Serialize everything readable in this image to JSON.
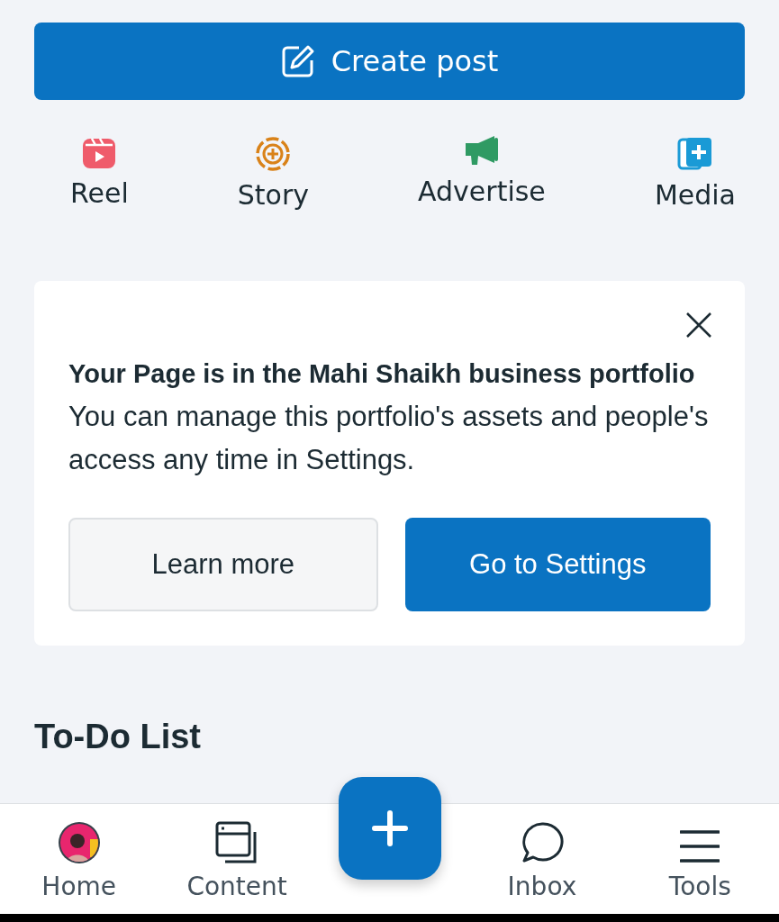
{
  "create_post": {
    "label": "Create post"
  },
  "quick_actions": [
    {
      "kind": "reel",
      "label": "Reel"
    },
    {
      "kind": "story",
      "label": "Story"
    },
    {
      "kind": "advertise",
      "label": "Advertise"
    },
    {
      "kind": "media",
      "label": "Media"
    }
  ],
  "notice": {
    "title": "Your Page is in the Mahi Shaikh business portfolio",
    "body": "You can manage this portfolio's assets and people's access any time in Settings.",
    "buttons": [
      {
        "kind": "secondary",
        "label": "Learn more"
      },
      {
        "kind": "primary",
        "label": "Go to Settings"
      }
    ]
  },
  "section_heading": "To-Do List",
  "bottom_nav": [
    {
      "kind": "avatar",
      "label": "Home"
    },
    {
      "kind": "content",
      "label": "Content"
    },
    {
      "kind": "fab"
    },
    {
      "kind": "inbox",
      "label": "Inbox"
    },
    {
      "kind": "tools",
      "label": "Tools"
    }
  ]
}
